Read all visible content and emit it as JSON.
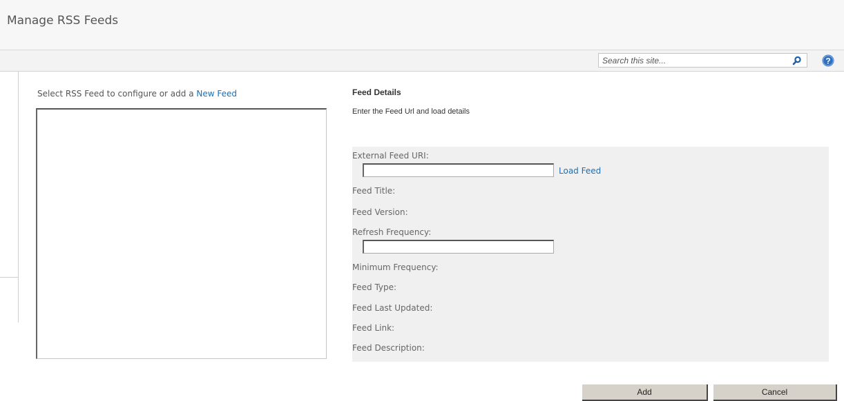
{
  "header": {
    "title": "Manage RSS Feeds"
  },
  "search": {
    "placeholder": "Search this site...",
    "icon": "search-icon"
  },
  "help": {
    "icon": "help-icon"
  },
  "left": {
    "intro_text": "Select RSS Feed to configure or add a ",
    "new_feed_link": "New Feed"
  },
  "details": {
    "heading": "Feed Details",
    "subtext": "Enter the Feed Url and load details",
    "external_uri_label": "External Feed URI:",
    "external_uri_value": "",
    "load_feed_link": "Load Feed",
    "feed_title_label": "Feed Title:",
    "feed_version_label": "Feed Version:",
    "refresh_frequency_label": "Refresh Frequency:",
    "refresh_frequency_value": "",
    "minimum_frequency_label": "Minimum Frequency:",
    "feed_type_label": "Feed Type:",
    "feed_last_updated_label": "Feed Last Updated:",
    "feed_link_label": "Feed Link:",
    "feed_description_label": "Feed Description:"
  },
  "actions": {
    "add_label": "Add",
    "cancel_label": "Cancel"
  },
  "colors": {
    "link": "#1a6fb5",
    "search_icon": "#1f5fa8",
    "help_icon": "#2f6fc0",
    "button_bg": "#d6d2c9"
  }
}
